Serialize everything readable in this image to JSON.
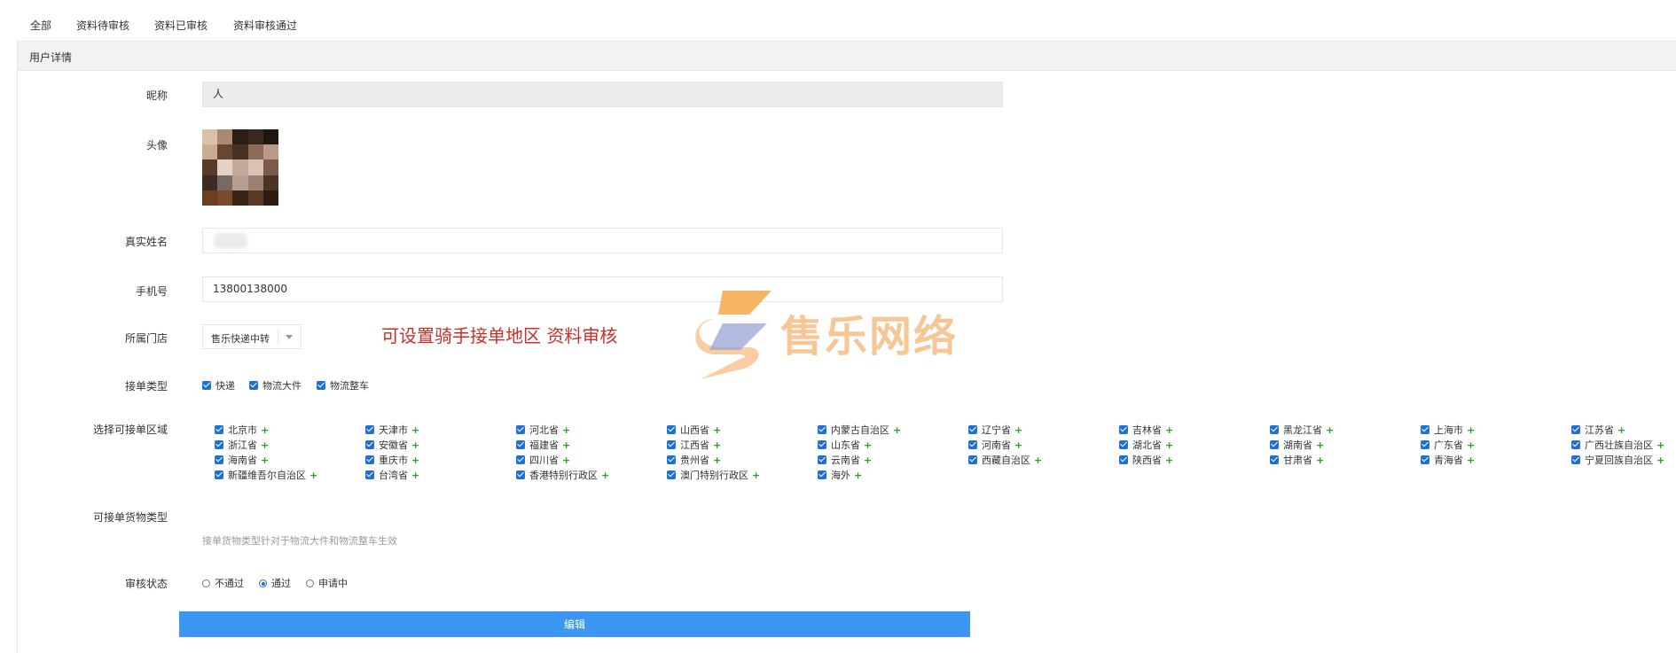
{
  "tabs": [
    {
      "label": "全部"
    },
    {
      "label": "资料待审核"
    },
    {
      "label": "资料已审核"
    },
    {
      "label": "资料审核通过"
    }
  ],
  "panel": {
    "title": "用户详情"
  },
  "form": {
    "nickname": {
      "label": "昵称",
      "value": "人"
    },
    "avatar": {
      "label": "头像"
    },
    "real_name": {
      "label": "真实姓名",
      "value": ""
    },
    "phone": {
      "label": "手机号",
      "value": "13800138000"
    },
    "store": {
      "label": "所属门店",
      "value": "售乐快递中转"
    },
    "order_type": {
      "label": "接单类型",
      "options": [
        {
          "label": "快递",
          "checked": true
        },
        {
          "label": "物流大件",
          "checked": true
        },
        {
          "label": "物流整车",
          "checked": true
        }
      ]
    },
    "regions": {
      "label": "选择可接单区域",
      "items": [
        "北京市",
        "天津市",
        "河北省",
        "山西省",
        "内蒙古自治区",
        "辽宁省",
        "吉林省",
        "黑龙江省",
        "上海市",
        "江苏省",
        "浙江省",
        "安徽省",
        "福建省",
        "江西省",
        "山东省",
        "河南省",
        "湖北省",
        "湖南省",
        "广东省",
        "广西壮族自治区",
        "海南省",
        "重庆市",
        "四川省",
        "贵州省",
        "云南省",
        "西藏自治区",
        "陕西省",
        "甘肃省",
        "青海省",
        "宁夏回族自治区",
        "新疆维吾尔自治区",
        "台湾省",
        "香港特别行政区",
        "澳门特别行政区",
        "海外"
      ],
      "plus_symbol": "+"
    },
    "cargo_type": {
      "label": "可接单货物类型",
      "hint": "接单货物类型针对于物流大件和物流整车生效"
    },
    "review_status": {
      "label": "审核状态",
      "options": [
        {
          "label": "不通过",
          "selected": false
        },
        {
          "label": "通过",
          "selected": true
        },
        {
          "label": "申请中",
          "selected": false
        }
      ]
    },
    "edit_button": "编辑"
  },
  "annotation": "可设置骑手接单地区  资料审核",
  "watermark": {
    "text": "售乐网络"
  },
  "colors": {
    "accent": "#3a96f0",
    "checkbox": "#1e6fd9",
    "plus": "#22a322",
    "annotation": "#c8302c",
    "watermark": "#f7c08a"
  }
}
